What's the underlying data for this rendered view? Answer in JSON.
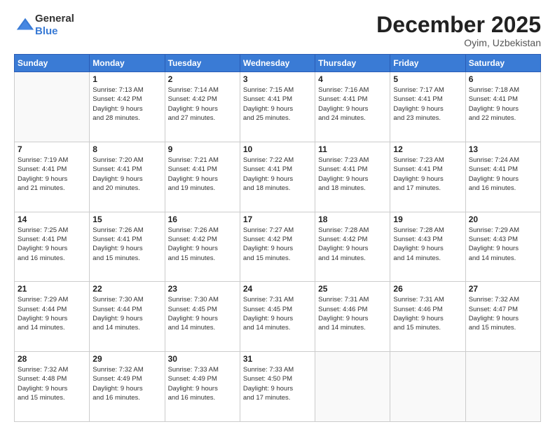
{
  "header": {
    "logo_line1": "General",
    "logo_line2": "Blue",
    "month_title": "December 2025",
    "location": "Oyim, Uzbekistan"
  },
  "days_of_week": [
    "Sunday",
    "Monday",
    "Tuesday",
    "Wednesday",
    "Thursday",
    "Friday",
    "Saturday"
  ],
  "weeks": [
    [
      {
        "day": "",
        "info": ""
      },
      {
        "day": "1",
        "info": "Sunrise: 7:13 AM\nSunset: 4:42 PM\nDaylight: 9 hours\nand 28 minutes."
      },
      {
        "day": "2",
        "info": "Sunrise: 7:14 AM\nSunset: 4:42 PM\nDaylight: 9 hours\nand 27 minutes."
      },
      {
        "day": "3",
        "info": "Sunrise: 7:15 AM\nSunset: 4:41 PM\nDaylight: 9 hours\nand 25 minutes."
      },
      {
        "day": "4",
        "info": "Sunrise: 7:16 AM\nSunset: 4:41 PM\nDaylight: 9 hours\nand 24 minutes."
      },
      {
        "day": "5",
        "info": "Sunrise: 7:17 AM\nSunset: 4:41 PM\nDaylight: 9 hours\nand 23 minutes."
      },
      {
        "day": "6",
        "info": "Sunrise: 7:18 AM\nSunset: 4:41 PM\nDaylight: 9 hours\nand 22 minutes."
      }
    ],
    [
      {
        "day": "7",
        "info": "Sunrise: 7:19 AM\nSunset: 4:41 PM\nDaylight: 9 hours\nand 21 minutes."
      },
      {
        "day": "8",
        "info": "Sunrise: 7:20 AM\nSunset: 4:41 PM\nDaylight: 9 hours\nand 20 minutes."
      },
      {
        "day": "9",
        "info": "Sunrise: 7:21 AM\nSunset: 4:41 PM\nDaylight: 9 hours\nand 19 minutes."
      },
      {
        "day": "10",
        "info": "Sunrise: 7:22 AM\nSunset: 4:41 PM\nDaylight: 9 hours\nand 18 minutes."
      },
      {
        "day": "11",
        "info": "Sunrise: 7:23 AM\nSunset: 4:41 PM\nDaylight: 9 hours\nand 18 minutes."
      },
      {
        "day": "12",
        "info": "Sunrise: 7:23 AM\nSunset: 4:41 PM\nDaylight: 9 hours\nand 17 minutes."
      },
      {
        "day": "13",
        "info": "Sunrise: 7:24 AM\nSunset: 4:41 PM\nDaylight: 9 hours\nand 16 minutes."
      }
    ],
    [
      {
        "day": "14",
        "info": "Sunrise: 7:25 AM\nSunset: 4:41 PM\nDaylight: 9 hours\nand 16 minutes."
      },
      {
        "day": "15",
        "info": "Sunrise: 7:26 AM\nSunset: 4:41 PM\nDaylight: 9 hours\nand 15 minutes."
      },
      {
        "day": "16",
        "info": "Sunrise: 7:26 AM\nSunset: 4:42 PM\nDaylight: 9 hours\nand 15 minutes."
      },
      {
        "day": "17",
        "info": "Sunrise: 7:27 AM\nSunset: 4:42 PM\nDaylight: 9 hours\nand 15 minutes."
      },
      {
        "day": "18",
        "info": "Sunrise: 7:28 AM\nSunset: 4:42 PM\nDaylight: 9 hours\nand 14 minutes."
      },
      {
        "day": "19",
        "info": "Sunrise: 7:28 AM\nSunset: 4:43 PM\nDaylight: 9 hours\nand 14 minutes."
      },
      {
        "day": "20",
        "info": "Sunrise: 7:29 AM\nSunset: 4:43 PM\nDaylight: 9 hours\nand 14 minutes."
      }
    ],
    [
      {
        "day": "21",
        "info": "Sunrise: 7:29 AM\nSunset: 4:44 PM\nDaylight: 9 hours\nand 14 minutes."
      },
      {
        "day": "22",
        "info": "Sunrise: 7:30 AM\nSunset: 4:44 PM\nDaylight: 9 hours\nand 14 minutes."
      },
      {
        "day": "23",
        "info": "Sunrise: 7:30 AM\nSunset: 4:45 PM\nDaylight: 9 hours\nand 14 minutes."
      },
      {
        "day": "24",
        "info": "Sunrise: 7:31 AM\nSunset: 4:45 PM\nDaylight: 9 hours\nand 14 minutes."
      },
      {
        "day": "25",
        "info": "Sunrise: 7:31 AM\nSunset: 4:46 PM\nDaylight: 9 hours\nand 14 minutes."
      },
      {
        "day": "26",
        "info": "Sunrise: 7:31 AM\nSunset: 4:46 PM\nDaylight: 9 hours\nand 15 minutes."
      },
      {
        "day": "27",
        "info": "Sunrise: 7:32 AM\nSunset: 4:47 PM\nDaylight: 9 hours\nand 15 minutes."
      }
    ],
    [
      {
        "day": "28",
        "info": "Sunrise: 7:32 AM\nSunset: 4:48 PM\nDaylight: 9 hours\nand 15 minutes."
      },
      {
        "day": "29",
        "info": "Sunrise: 7:32 AM\nSunset: 4:49 PM\nDaylight: 9 hours\nand 16 minutes."
      },
      {
        "day": "30",
        "info": "Sunrise: 7:33 AM\nSunset: 4:49 PM\nDaylight: 9 hours\nand 16 minutes."
      },
      {
        "day": "31",
        "info": "Sunrise: 7:33 AM\nSunset: 4:50 PM\nDaylight: 9 hours\nand 17 minutes."
      },
      {
        "day": "",
        "info": ""
      },
      {
        "day": "",
        "info": ""
      },
      {
        "day": "",
        "info": ""
      }
    ]
  ]
}
